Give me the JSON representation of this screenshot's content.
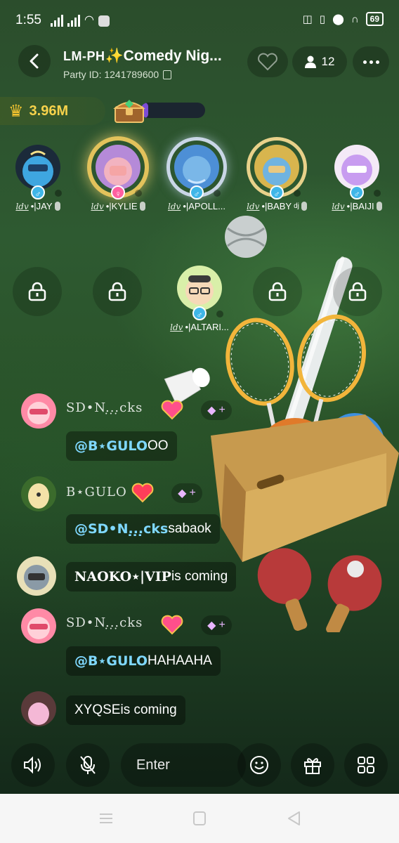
{
  "status_bar": {
    "time": "1:55",
    "battery": "69"
  },
  "header": {
    "prefix": "LM-PH",
    "spark": "✨",
    "title": "Comedy Nig...",
    "party_id": "Party ID: 1241789600",
    "member_count": "12"
  },
  "coins": {
    "value": "3.96M",
    "progress": 0.12
  },
  "seats_row1": [
    {
      "name": "•|JAY",
      "gender": "♂"
    },
    {
      "name": "•|KYLIE",
      "gender": "♀"
    },
    {
      "name": "•|APOLL...",
      "gender": "♂"
    },
    {
      "name": "•|BABY",
      "gender": "♂",
      "sup": "dj"
    },
    {
      "name": "•|BAIJI",
      "gender": "♂"
    }
  ],
  "seat_host": {
    "name": "•|ALTARI...",
    "gender": "♂"
  },
  "tag_label": "ldv",
  "chat": [
    {
      "name": "SD•N.̣.̣.̣cks",
      "message_mention": "@B⋆GULO",
      "message_text": " OO"
    },
    {
      "name": "B⋆GULO",
      "message_mention": "@SD•N.̣.̣.̣cks",
      "message_text": " sabaok"
    },
    {
      "name": "",
      "message_mention": "",
      "message_user": "NAOKO⋆|VIP",
      "message_text": " is coming"
    },
    {
      "name": "SD•N.̣.̣.̣cks",
      "message_mention": "@B⋆GULO",
      "message_text": " HAHAAHA"
    },
    {
      "name": "",
      "message_mention": "",
      "message_user": "XYQSE",
      "message_text": " is coming"
    }
  ],
  "bottom_bar": {
    "input_placeholder": "Enter"
  },
  "colors": {
    "accent_gold": "#f7d24b",
    "mention_blue": "#7fd8ff",
    "male_blue": "#3fb6e8",
    "female_pink": "#ff5fa0"
  },
  "icons": [
    "back-arrow-icon",
    "heart-icon",
    "person-icon",
    "more-icon",
    "crown-icon",
    "chest-icon",
    "lock-icon",
    "speaker-icon",
    "mic-muted-icon",
    "smiley-icon",
    "gift-icon",
    "grid-icon"
  ]
}
